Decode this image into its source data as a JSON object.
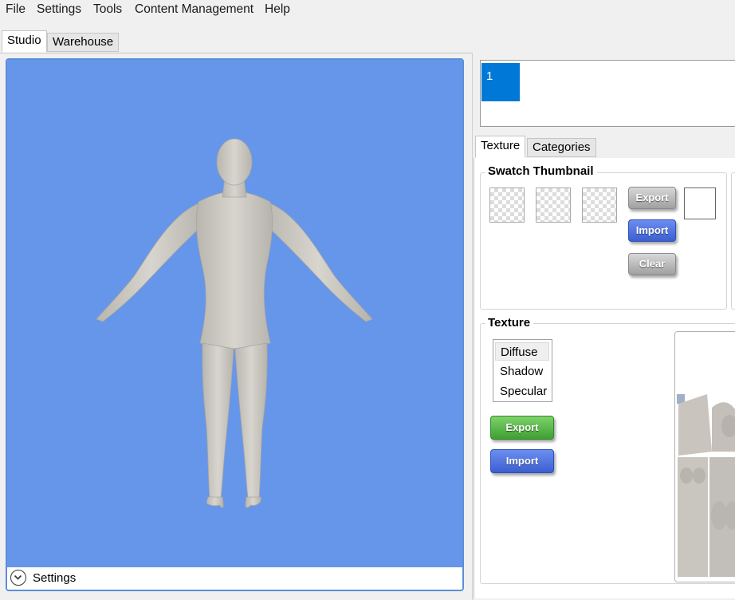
{
  "menu": {
    "items": [
      {
        "label": "File"
      },
      {
        "label": "Settings"
      },
      {
        "label": "Tools"
      },
      {
        "label": "Content Management"
      },
      {
        "label": "Help"
      }
    ]
  },
  "main_tabs": [
    {
      "label": "Studio",
      "active": true
    },
    {
      "label": "Warehouse",
      "active": false
    }
  ],
  "viewport": {
    "background": "#6696ea",
    "settings_label": "Settings"
  },
  "layers": {
    "items": [
      {
        "label": "1",
        "selected": true
      }
    ],
    "selected_color": "#0078d7"
  },
  "sub_tabs": [
    {
      "label": "Texture",
      "active": true
    },
    {
      "label": "Categories",
      "active": false
    }
  ],
  "swatch": {
    "title": "Swatch Thumbnail",
    "export_label": "Export",
    "import_label": "Import",
    "clear_label": "Clear"
  },
  "texture": {
    "title": "Texture",
    "channels": [
      {
        "label": "Diffuse",
        "selected": true
      },
      {
        "label": "Shadow",
        "selected": false
      },
      {
        "label": "Specular",
        "selected": false
      }
    ],
    "export_label": "Export",
    "import_label": "Import"
  }
}
